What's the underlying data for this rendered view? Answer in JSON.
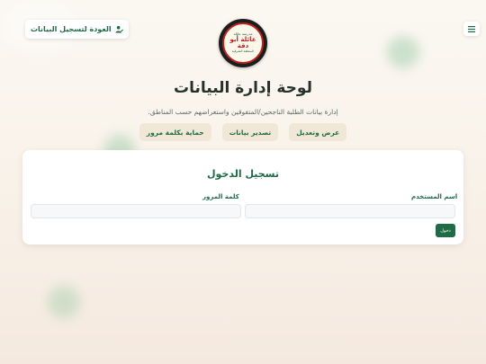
{
  "header": {
    "back_label": "العودة لتسجيل البيانات",
    "back_icon": "user-edit-icon",
    "menu_icon": "hamburger-icon"
  },
  "logo": {
    "line1": "مدرسة عائلة",
    "line2": "عائلة أبو دقة",
    "line3": "المنطقة الشرقية"
  },
  "page": {
    "title": "لوحة إدارة البيانات",
    "subtitle": "إدارة بيانات الطلبة الناجحين/المتفوقين واستعراضهم حسب المناطق."
  },
  "features": [
    {
      "label": "عرض وتعديل"
    },
    {
      "label": "تصدير بيانات"
    },
    {
      "label": "حماية بكلمة مرور"
    }
  ],
  "login": {
    "title": "تسجيل الدخول",
    "username_label": "اسم المستخدم",
    "username_value": "",
    "password_label": "كلمة المرور",
    "password_value": "",
    "submit_label": "دخول"
  },
  "colors": {
    "accent": "#1e6b45",
    "feature_bg": "#f1e7d6",
    "logo_red": "#b8241f"
  }
}
